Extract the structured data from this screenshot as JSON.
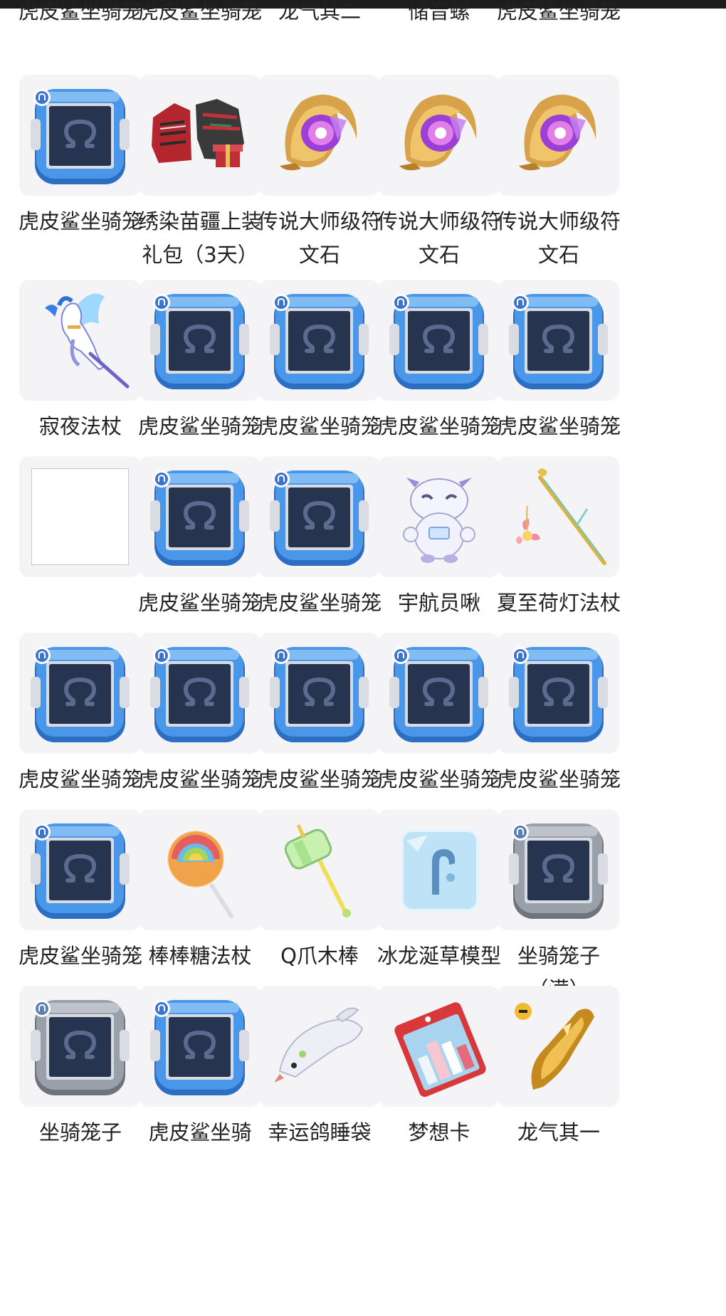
{
  "colors": {
    "cage_blue": "#3f8ee6",
    "cage_blue_dark": "#2a6fc4",
    "cage_screen": "#26344f",
    "cage_gray": "#8a8f99",
    "thumb_bg": "#f4f4f6",
    "text": "#222222"
  },
  "top_partial_row": [
    {
      "label": "虎皮鲨坐骑笼"
    },
    {
      "label": "虎皮鲨坐骑笼"
    },
    {
      "label": "龙气其二"
    },
    {
      "label": "储音螺"
    },
    {
      "label": "虎皮鲨坐骑笼"
    }
  ],
  "rows": [
    [
      {
        "label": "虎皮鲨坐骑笼",
        "icon": "mount-cage-blue-icon"
      },
      {
        "label": "绣染苗疆上装礼包（3天）",
        "icon": "clothing-gift-pack-icon"
      },
      {
        "label": "传说大师级符文石",
        "icon": "rune-stone-icon"
      },
      {
        "label": "传说大师级符文石",
        "icon": "rune-stone-icon"
      },
      {
        "label": "传说大师级符文石",
        "icon": "rune-stone-icon"
      }
    ],
    [
      {
        "label": "寂夜法杖",
        "icon": "pegasus-staff-icon"
      },
      {
        "label": "虎皮鲨坐骑笼",
        "icon": "mount-cage-blue-icon"
      },
      {
        "label": "虎皮鲨坐骑笼",
        "icon": "mount-cage-blue-icon"
      },
      {
        "label": "虎皮鲨坐骑笼",
        "icon": "mount-cage-blue-icon"
      },
      {
        "label": "虎皮鲨坐骑笼",
        "icon": "mount-cage-blue-icon"
      }
    ],
    [
      {
        "label": "",
        "icon": "blank-image-placeholder"
      },
      {
        "label": "虎皮鲨坐骑笼",
        "icon": "mount-cage-blue-icon"
      },
      {
        "label": "虎皮鲨坐骑笼",
        "icon": "mount-cage-blue-icon"
      },
      {
        "label": "宇航员啾",
        "icon": "astronaut-pet-icon"
      },
      {
        "label": "夏至荷灯法杖",
        "icon": "lotus-lamp-staff-icon"
      }
    ],
    [
      {
        "label": "虎皮鲨坐骑笼",
        "icon": "mount-cage-blue-icon"
      },
      {
        "label": "虎皮鲨坐骑笼",
        "icon": "mount-cage-blue-icon"
      },
      {
        "label": "虎皮鲨坐骑笼",
        "icon": "mount-cage-blue-icon"
      },
      {
        "label": "虎皮鲨坐骑笼",
        "icon": "mount-cage-blue-icon"
      },
      {
        "label": "虎皮鲨坐骑笼",
        "icon": "mount-cage-blue-icon"
      }
    ],
    [
      {
        "label": "虎皮鲨坐骑笼",
        "icon": "mount-cage-blue-icon"
      },
      {
        "label": "棒棒糖法杖",
        "icon": "lollipop-staff-icon"
      },
      {
        "label": "Q爪木棒",
        "icon": "q-claw-hammer-icon"
      },
      {
        "label": "冰龙涎草模型",
        "icon": "ice-dragon-model-icon"
      },
      {
        "label": "坐骑笼子（满）",
        "icon": "mount-cage-gray-icon"
      }
    ],
    [
      {
        "label": "坐骑笼子",
        "icon": "mount-cage-gray-icon"
      },
      {
        "label": "虎皮鲨坐骑",
        "icon": "mount-cage-blue-icon"
      },
      {
        "label": "幸运鸽睡袋",
        "icon": "pigeon-sleeping-bag-icon"
      },
      {
        "label": "梦想卡",
        "icon": "dream-card-icon"
      },
      {
        "label": "龙气其一",
        "icon": "dragon-qi-crystal-icon"
      }
    ]
  ]
}
